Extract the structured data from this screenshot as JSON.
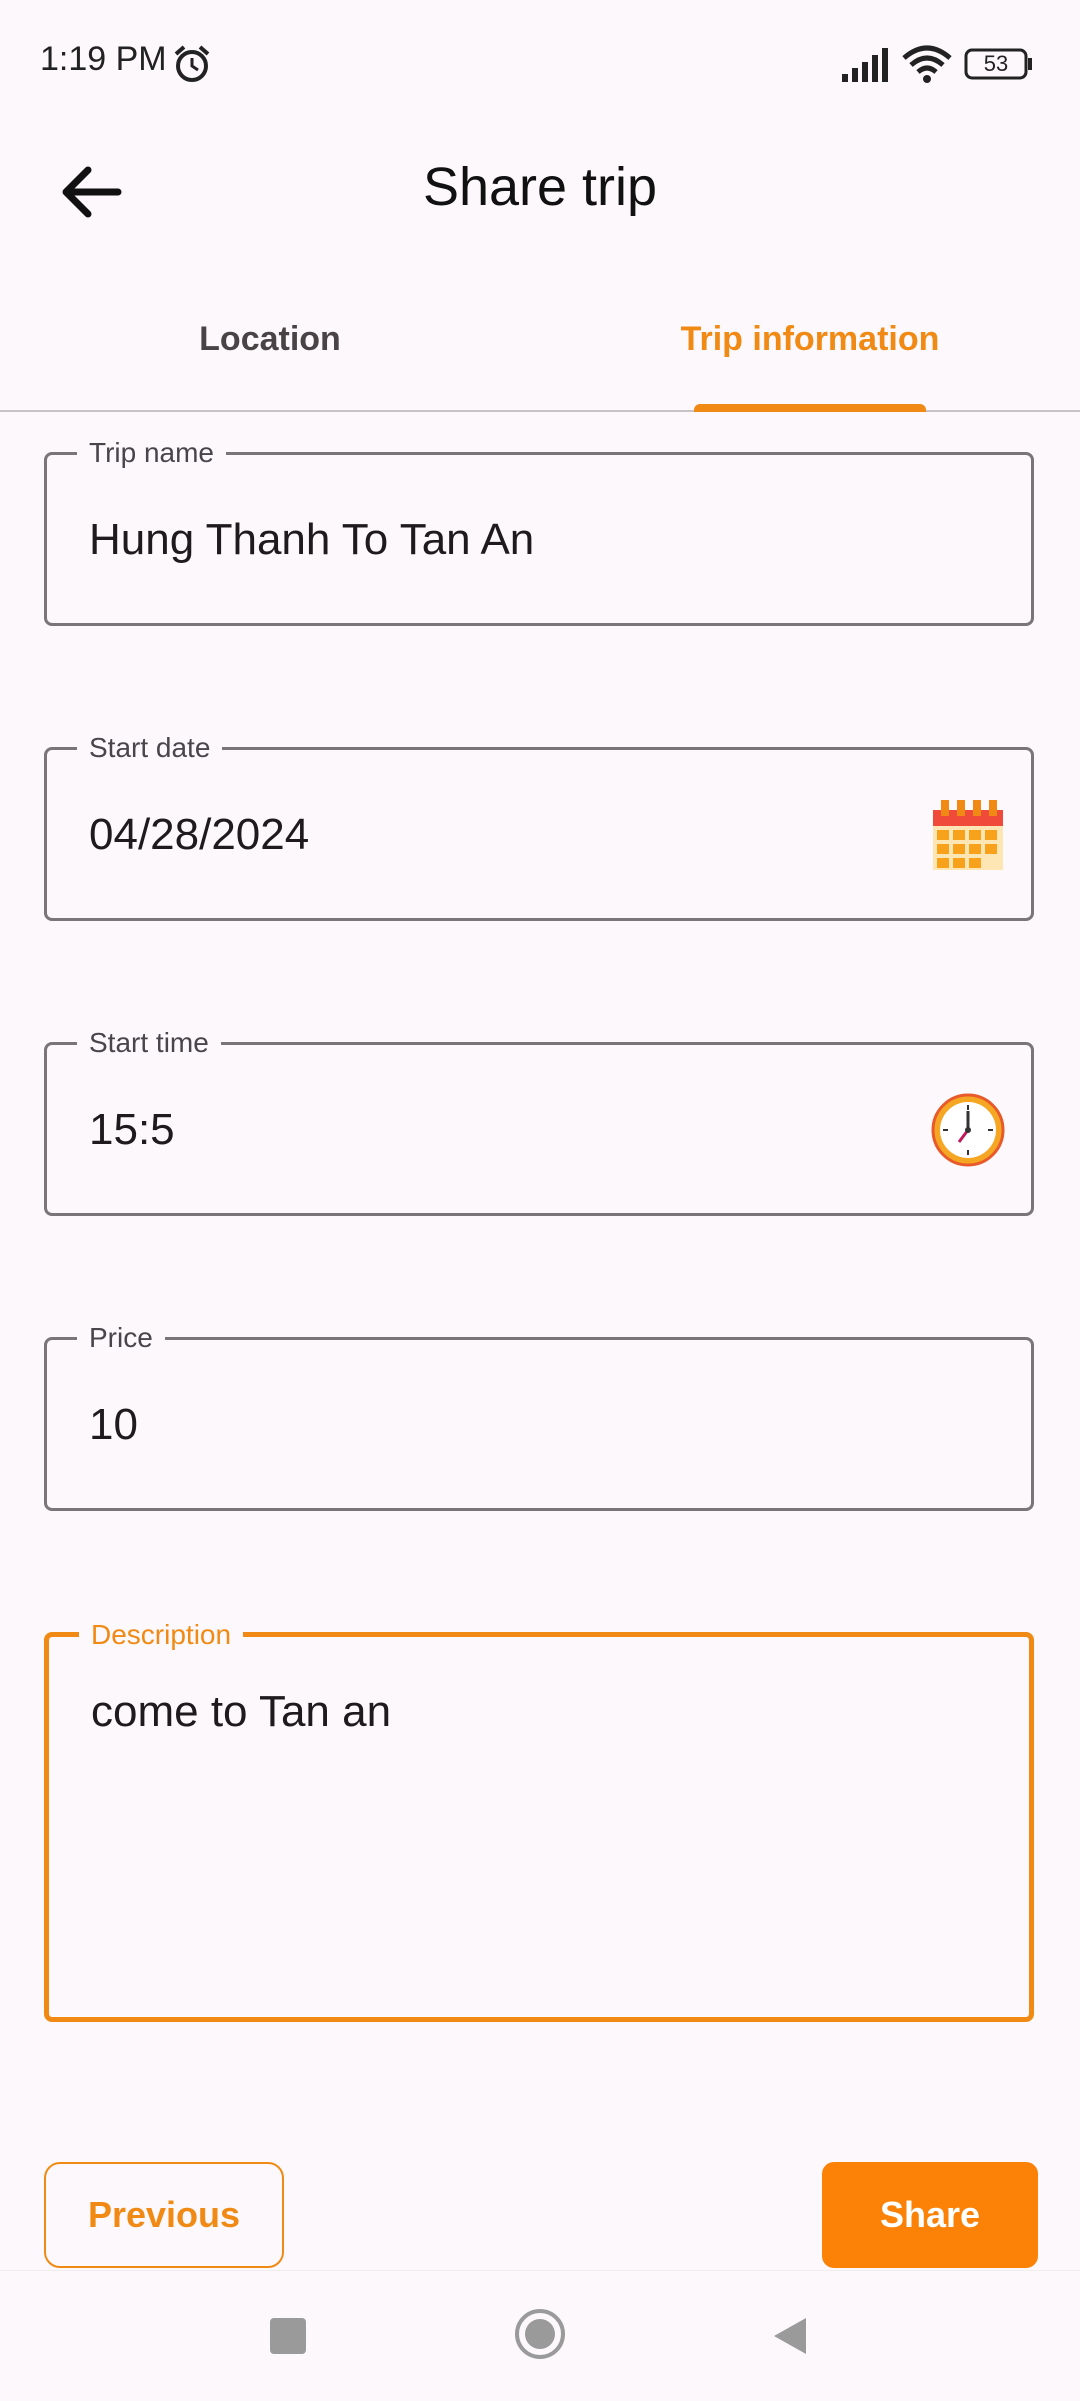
{
  "status_bar": {
    "time": "1:19 PM",
    "battery": "53"
  },
  "header": {
    "title": "Share trip"
  },
  "tabs": [
    {
      "label": "Location",
      "selected": false
    },
    {
      "label": "Trip information",
      "selected": true
    }
  ],
  "fields": {
    "trip_name": {
      "label": "Trip name",
      "value": "Hung Thanh To Tan An"
    },
    "start_date": {
      "label": "Start date",
      "value": "04/28/2024",
      "icon": "calendar-icon"
    },
    "start_time": {
      "label": "Start time",
      "value": "15:5",
      "icon": "clock-icon"
    },
    "price": {
      "label": "Price",
      "value": "10"
    },
    "description": {
      "label": "Description",
      "value": "come to Tan an"
    }
  },
  "buttons": {
    "previous": "Previous",
    "share": "Share"
  },
  "colors": {
    "accent": "#f08a14",
    "background": "#fdf8fb",
    "share_button": "#fb8207"
  }
}
